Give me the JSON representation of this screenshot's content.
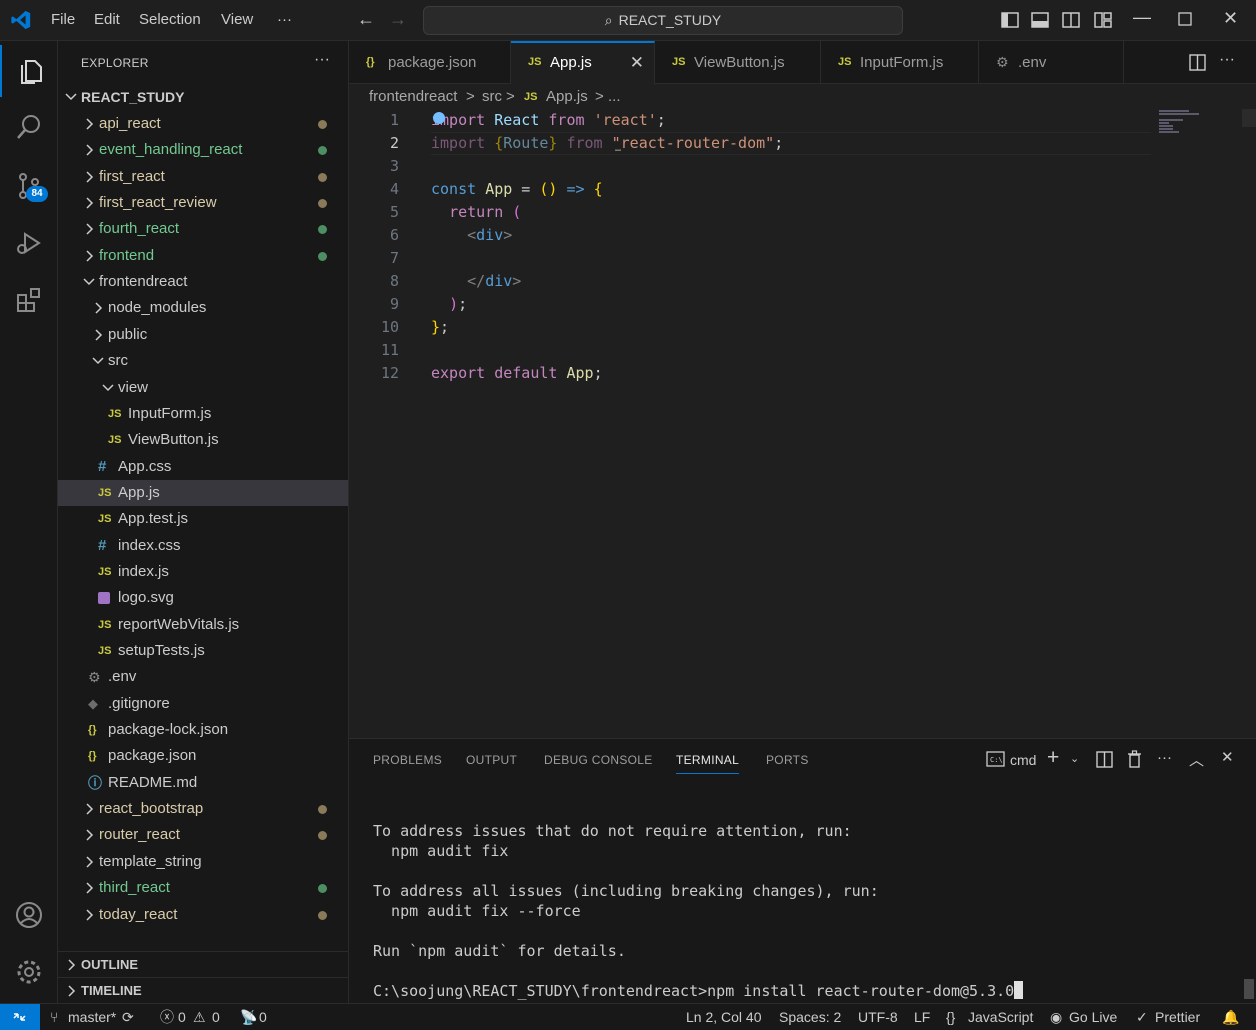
{
  "menu": [
    "File",
    "Edit",
    "Selection",
    "View",
    "···"
  ],
  "search": {
    "text": "REACT_STUDY"
  },
  "activity": {
    "scm_badge": "84"
  },
  "sidebar": {
    "title": "EXPLORER",
    "more": "···",
    "root": "REACT_STUDY",
    "items": [
      {
        "label": "api_react",
        "color": "#d8ccab",
        "dot": "#8b7a5a"
      },
      {
        "label": "event_handling_react",
        "color": "#73c991",
        "dot": "#4d8f63"
      },
      {
        "label": "first_react",
        "color": "#d8ccab",
        "dot": "#8b7a5a"
      },
      {
        "label": "first_react_review",
        "color": "#d8ccab",
        "dot": "#8b7a5a"
      },
      {
        "label": "fourth_react",
        "color": "#73c991",
        "dot": "#4d8f63"
      },
      {
        "label": "frontend",
        "color": "#73c991",
        "dot": "#4d8f63"
      },
      {
        "label": "frontendreact",
        "color": "#cccccc"
      },
      {
        "label": "node_modules",
        "color": "#cccccc"
      },
      {
        "label": "public",
        "color": "#cccccc"
      },
      {
        "label": "src",
        "color": "#cccccc"
      },
      {
        "label": "view",
        "color": "#cccccc"
      },
      {
        "label": "InputForm.js",
        "color": "#cccccc",
        "icon": "JS"
      },
      {
        "label": "ViewButton.js",
        "color": "#cccccc",
        "icon": "JS"
      },
      {
        "label": "App.css",
        "color": "#cccccc",
        "icon": "#"
      },
      {
        "label": "App.js",
        "color": "#cccccc",
        "icon": "JS"
      },
      {
        "label": "App.test.js",
        "color": "#cccccc",
        "icon": "JS"
      },
      {
        "label": "index.css",
        "color": "#cccccc",
        "icon": "#"
      },
      {
        "label": "index.js",
        "color": "#cccccc",
        "icon": "JS"
      },
      {
        "label": "logo.svg",
        "color": "#cccccc"
      },
      {
        "label": "reportWebVitals.js",
        "color": "#cccccc",
        "icon": "JS"
      },
      {
        "label": "setupTests.js",
        "color": "#cccccc",
        "icon": "JS"
      },
      {
        "label": ".env",
        "color": "#cccccc"
      },
      {
        "label": ".gitignore",
        "color": "#cccccc"
      },
      {
        "label": "package-lock.json",
        "color": "#cccccc",
        "icon": "{}"
      },
      {
        "label": "package.json",
        "color": "#cccccc",
        "icon": "{}"
      },
      {
        "label": "README.md",
        "color": "#cccccc"
      },
      {
        "label": "react_bootstrap",
        "color": "#d8ccab",
        "dot": "#8b7a5a"
      },
      {
        "label": "router_react",
        "color": "#d8ccab",
        "dot": "#8b7a5a"
      },
      {
        "label": "template_string",
        "color": "#cccccc"
      },
      {
        "label": "third_react",
        "color": "#73c991",
        "dot": "#4d8f63"
      },
      {
        "label": "today_react",
        "color": "#d8ccab",
        "dot": "#8b7a5a"
      }
    ],
    "outline": "OUTLINE",
    "timeline": "TIMELINE"
  },
  "tabs": [
    {
      "label": "package.json",
      "icon": "{}"
    },
    {
      "label": "App.js",
      "icon": "JS",
      "active": true,
      "close": "✕"
    },
    {
      "label": "ViewButton.js",
      "icon": "JS"
    },
    {
      "label": "InputForm.js",
      "icon": "JS"
    },
    {
      "label": ".env",
      "icon": "gear"
    }
  ],
  "breadcrumb": [
    "frontendreact",
    ">",
    "src",
    ">",
    "JS",
    "App.js",
    ">",
    "..."
  ],
  "editor": {
    "line_numbers": [
      "1",
      "2",
      "3",
      "4",
      "5",
      "6",
      "7",
      "8",
      "9",
      "10",
      "11",
      "12"
    ],
    "current_line": 2
  },
  "panel": {
    "tabs": [
      "PROBLEMS",
      "OUTPUT",
      "DEBUG CONSOLE",
      "TERMINAL",
      "PORTS"
    ],
    "shell": "cmd",
    "terminal_lines": [
      "To address issues that do not require attention, run:",
      "  npm audit fix",
      "",
      "To address all issues (including breaking changes), run:",
      "  npm audit fix --force",
      "",
      "Run `npm audit` for details.",
      "",
      "C:\\soojung\\REACT_STUDY\\frontendreact>npm install react-router-dom@5.3.0"
    ]
  },
  "status": {
    "branch": "master*",
    "errors": "0",
    "warnings": "0",
    "ports": "0",
    "position": "Ln 2, Col 40",
    "spaces": "Spaces: 2",
    "encoding": "UTF-8",
    "eol": "LF",
    "language": "JavaScript",
    "golive": "Go Live",
    "prettier": "Prettier"
  }
}
